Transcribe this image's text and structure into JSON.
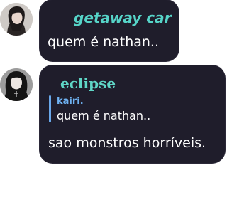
{
  "messages": [
    {
      "author": "getaway car",
      "text": "quem é nathan..",
      "avatar_icon": "user-avatar-icon",
      "author_color": "#56d4c8"
    },
    {
      "author": "eclipse",
      "text": "sao monstros horríveis.",
      "avatar_icon": "user-avatar-icon",
      "author_color": "#5fd6c6",
      "reply": {
        "author": "kairi.",
        "text": "quem é nathan.."
      }
    }
  ],
  "colors": {
    "bubble_bg": "#1f1d2b",
    "reply_bar": "#6aa8ea",
    "reply_author": "#6fb2f2",
    "message_text": "#ffffff"
  }
}
